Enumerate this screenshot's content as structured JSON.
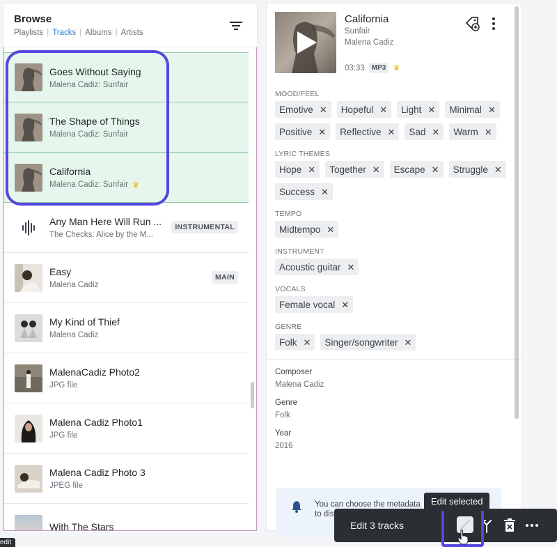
{
  "browse": {
    "title": "Browse",
    "tabs": [
      {
        "label": "Playlists",
        "active": false
      },
      {
        "label": "Tracks",
        "active": true
      },
      {
        "label": "Albums",
        "active": false
      },
      {
        "label": "Artists",
        "active": false
      }
    ],
    "filter_icon": "filter-icon"
  },
  "tracks": [
    {
      "title": "Goes Without Saying",
      "subtitle": "Malena Cadiz: Sunfair",
      "badge": "",
      "crown": false,
      "selected": true,
      "thumb": "windblown-portrait"
    },
    {
      "title": "The Shape of Things",
      "subtitle": "Malena Cadiz: Sunfair",
      "badge": "",
      "crown": false,
      "selected": true,
      "thumb": "windblown-portrait"
    },
    {
      "title": "California",
      "subtitle": "Malena Cadiz: Sunfair",
      "badge": "",
      "crown": true,
      "selected": true,
      "thumb": "windblown-portrait"
    },
    {
      "title": "Any Man Here Will Run ...",
      "subtitle": "The Checks: Alice by the M...",
      "badge": "INSTRUMENTAL",
      "crown": false,
      "selected": false,
      "thumb": "waveform-icon"
    },
    {
      "title": "Easy",
      "subtitle": "Malena Cadiz",
      "badge": "MAIN",
      "crown": false,
      "selected": false,
      "thumb": "woman-photo"
    },
    {
      "title": "My Kind of Thief",
      "subtitle": "Malena Cadiz",
      "badge": "",
      "crown": false,
      "selected": false,
      "thumb": "two-figures-photo"
    },
    {
      "title": "MalenaCadiz Photo2",
      "subtitle": "JPG file",
      "badge": "",
      "crown": false,
      "selected": false,
      "thumb": "standing-figure-photo"
    },
    {
      "title": "Malena Cadiz Photo1",
      "subtitle": "JPG file",
      "badge": "",
      "crown": false,
      "selected": false,
      "thumb": "dark-hair-photo"
    },
    {
      "title": "Malena Cadiz Photo 3",
      "subtitle": "JPEG file",
      "badge": "",
      "crown": false,
      "selected": false,
      "thumb": "reclining-photo"
    },
    {
      "title": "With The Stars",
      "subtitle": "",
      "badge": "",
      "crown": false,
      "selected": false,
      "thumb": "sky-photo"
    }
  ],
  "crown_glyph": "♛",
  "detail": {
    "title": "California",
    "album": "Sunfair",
    "artist": "Malena Cadiz",
    "duration": "03:33",
    "format": "MP3",
    "crown": true
  },
  "tag_groups": [
    {
      "label": "MOOD/FEEL",
      "tags": [
        "Emotive",
        "Hopeful",
        "Light",
        "Minimal",
        "Positive",
        "Reflective",
        "Sad",
        "Warm"
      ]
    },
    {
      "label": "LYRIC THEMES",
      "tags": [
        "Hope",
        "Together",
        "Escape",
        "Struggle",
        "Success"
      ]
    },
    {
      "label": "TEMPO",
      "tags": [
        "Midtempo"
      ]
    },
    {
      "label": "INSTRUMENT",
      "tags": [
        "Acoustic guitar"
      ]
    },
    {
      "label": "VOCALS",
      "tags": [
        "Female vocal"
      ]
    },
    {
      "label": "GENRE",
      "tags": [
        "Folk",
        "Singer/songwriter"
      ]
    }
  ],
  "metadata": [
    {
      "label": "Composer",
      "value": "Malena Cadiz"
    },
    {
      "label": "Genre",
      "value": "Folk"
    },
    {
      "label": "Year",
      "value": "2016"
    }
  ],
  "info": {
    "line1": "You can choose the metadata",
    "line2": "to dis"
  },
  "action_bar": {
    "label": "Edit 3 tracks",
    "tooltip": "Edit selected",
    "mini_tooltip": "edit"
  },
  "colors": {
    "accent_tab": "#2f7ec2",
    "selected_row": "#e6f6ec",
    "highlight": "#5546dd",
    "action_bar": "#2b2e33",
    "crown": "#e8b400"
  }
}
